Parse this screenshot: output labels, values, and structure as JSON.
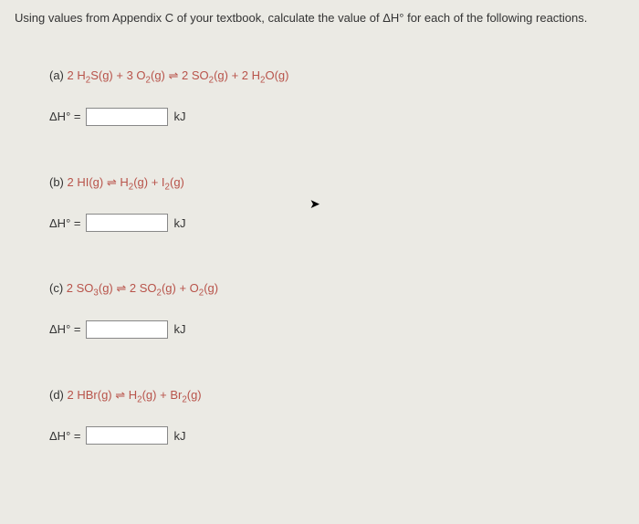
{
  "instruction": "Using values from Appendix C of your textbook, calculate the value of ΔH° for each of the following reactions.",
  "questions": {
    "a": {
      "label": "(a)",
      "lhs1_coef": "2 H",
      "lhs1_sub": "2",
      "lhs1_compound": "S(g)",
      "plus1": " + ",
      "lhs2_coef": "3 O",
      "lhs2_sub": "2",
      "lhs2_state": "(g)",
      "arrow": " ⇌ ",
      "rhs1_coef": "2 SO",
      "rhs1_sub": "2",
      "rhs1_state": "(g)",
      "plus2": " + ",
      "rhs2_coef": "2 H",
      "rhs2_sub": "2",
      "rhs2_compound": "O(g)"
    },
    "b": {
      "label": "(b)",
      "lhs1": "2 HI(g)",
      "arrow": " ⇌ ",
      "rhs1": "H",
      "rhs1_sub": "2",
      "rhs1_state": "(g)",
      "plus": " + ",
      "rhs2": "I",
      "rhs2_sub": "2",
      "rhs2_state": "(g)"
    },
    "c": {
      "label": "(c)",
      "lhs1": "2 SO",
      "lhs1_sub": "3",
      "lhs1_state": "(g)",
      "arrow": " ⇌ ",
      "rhs1": "2 SO",
      "rhs1_sub": "2",
      "rhs1_state": "(g)",
      "plus": " + ",
      "rhs2": "O",
      "rhs2_sub": "2",
      "rhs2_state": "(g)"
    },
    "d": {
      "label": "(d)",
      "lhs1": "2 HBr(g)",
      "arrow": " ⇌ ",
      "rhs1": "H",
      "rhs1_sub": "2",
      "rhs1_state": "(g)",
      "plus": " + ",
      "rhs2": "Br",
      "rhs2_sub": "2",
      "rhs2_state": "(g)"
    }
  },
  "answer": {
    "delta": "ΔH° =",
    "unit": "kJ"
  }
}
